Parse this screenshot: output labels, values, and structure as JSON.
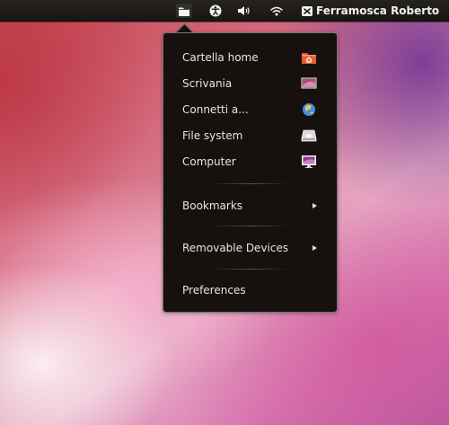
{
  "top_panel": {
    "user_name": "Ferramosca Roberto",
    "indicators": [
      {
        "name": "places-icon",
        "active": true
      },
      {
        "name": "accessibility-icon",
        "active": false
      },
      {
        "name": "volume-icon",
        "active": false
      },
      {
        "name": "wifi-icon",
        "active": false
      },
      {
        "name": "user-status-icon",
        "active": false
      }
    ]
  },
  "places_menu": {
    "items": [
      {
        "label": "Cartella home",
        "icon": "home-folder-icon"
      },
      {
        "label": "Scrivania",
        "icon": "desktop-icon"
      },
      {
        "label": "Connetti a...",
        "icon": "network-globe-icon"
      },
      {
        "label": "File system",
        "icon": "drive-icon"
      },
      {
        "label": "Computer",
        "icon": "computer-monitor-icon"
      },
      {
        "label": "Bookmarks",
        "submenu": true
      },
      {
        "label": "Removable Devices",
        "submenu": true
      },
      {
        "label": "Preferences"
      }
    ]
  },
  "colors": {
    "panel_background": "#1f1c19",
    "menu_background": "#16100f",
    "menu_border": "#7b7472",
    "menu_text": "#e9e5e3"
  }
}
